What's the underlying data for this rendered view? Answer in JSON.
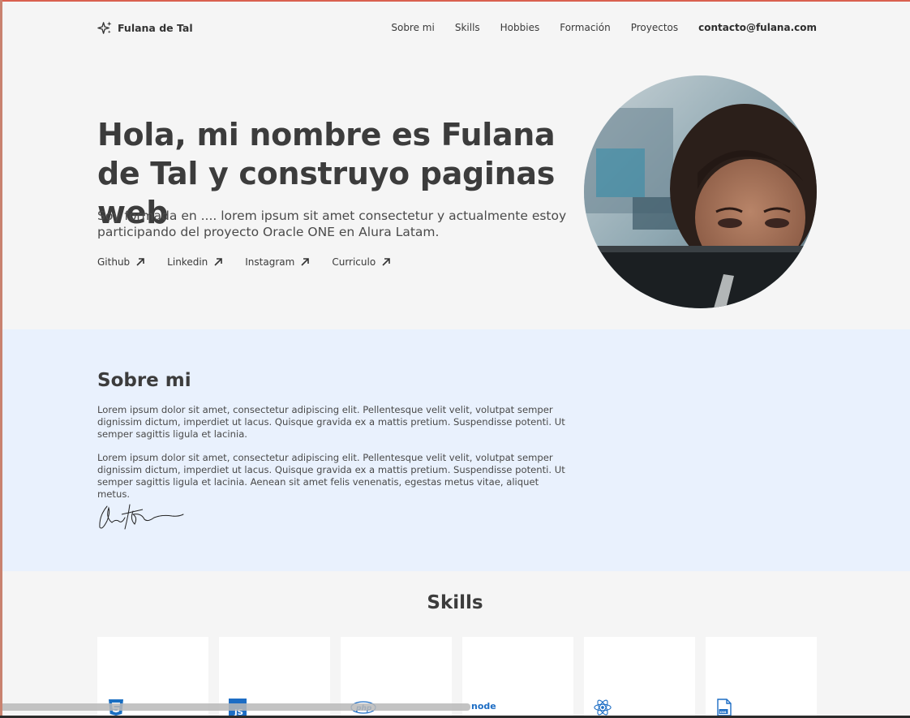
{
  "header": {
    "brand": "Fulana de Tal",
    "nav": [
      "Sobre mi",
      "Skills",
      "Hobbies",
      "Formación",
      "Proyectos"
    ],
    "contact": "contacto@fulana.com"
  },
  "hero": {
    "title": "Hola, mi nombre es Fulana de Tal y construyo paginas web",
    "description": "Soy formada en .... lorem ipsum sit amet consectetur y actualmente estoy participando del proyecto Oracle ONE en Alura Latam.",
    "links": [
      "Github",
      "Linkedin",
      "Instagram",
      "Curriculo"
    ]
  },
  "about": {
    "title": "Sobre mi",
    "p1": "Lorem ipsum dolor sit amet, consectetur adipiscing elit. Pellentesque velit velit, volutpat semper dignissim dictum, imperdiet ut lacus. Quisque gravida ex a mattis pretium. Suspendisse potenti. Ut semper sagittis ligula et lacinia.",
    "p2": "Lorem ipsum dolor sit amet, consectetur adipiscing elit. Pellentesque velit velit, volutpat semper dignissim dictum, imperdiet ut lacus. Quisque gravida ex a mattis pretium. Suspendisse potenti. Ut semper sagittis ligula et lacinia. Aenean sit amet felis venenatis, egestas metus vitae, aliquet metus."
  },
  "skills": {
    "title": "Skills",
    "cards": [
      {
        "icon": "css3-icon",
        "label": ""
      },
      {
        "icon": "javascript-icon",
        "label": "JS"
      },
      {
        "icon": "php-icon",
        "label": "php"
      },
      {
        "icon": "nodejs-icon",
        "label": "node"
      },
      {
        "icon": "react-icon",
        "label": ""
      },
      {
        "icon": "css-file-icon",
        "label": "css"
      }
    ]
  },
  "colors": {
    "background": "#f5f5f5",
    "about_background": "#e9f1fd",
    "text": "#464646",
    "card": "#ffffff"
  }
}
